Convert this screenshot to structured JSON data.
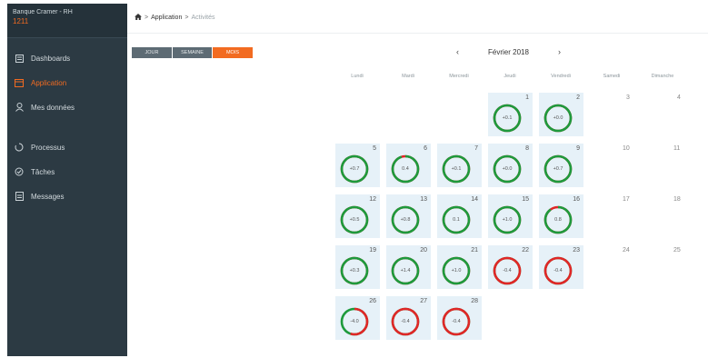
{
  "sidebar": {
    "brand_name": "Banque Cramer - RH",
    "brand_code": "1211",
    "items": [
      {
        "label": "Dashboards",
        "icon": "dashboard-icon"
      },
      {
        "label": "Application",
        "icon": "application-icon"
      },
      {
        "label": "Mes données",
        "icon": "user-icon"
      },
      {
        "label": "Processus",
        "icon": "process-icon"
      },
      {
        "label": "Tâches",
        "icon": "check-circle-icon"
      },
      {
        "label": "Messages",
        "icon": "messages-icon"
      }
    ]
  },
  "breadcrumb": {
    "home_icon": "home-icon",
    "item1": "Application",
    "item2": "Activités",
    "separator": ">"
  },
  "view_toggle": {
    "day": "JOUR",
    "week": "SEMAINE",
    "month": "MOIS"
  },
  "calendar": {
    "month_label": "Février 2018",
    "prev": "‹",
    "next": "›",
    "weekdays": [
      "Lundi",
      "Mardi",
      "Mercredi",
      "Jeudi",
      "Vendredi",
      "Samedi",
      "Dimanche"
    ],
    "weekend_days": {
      "3": "3",
      "4": "4",
      "10": "10",
      "11": "11",
      "17": "17",
      "18": "18",
      "24": "24",
      "25": "25"
    },
    "days": [
      {
        "day": "1",
        "value": "+0.1",
        "ring_fraction": 1.0,
        "color": "#1e9a3c"
      },
      {
        "day": "2",
        "value": "+0.0",
        "ring_fraction": 1.0,
        "color": "#1e9a3c"
      },
      {
        "day": "5",
        "value": "+0.7",
        "ring_fraction": 1.0,
        "color": "#1e9a3c"
      },
      {
        "day": "6",
        "value": "0.4",
        "ring_fraction": 0.95,
        "color": "#1e9a3c"
      },
      {
        "day": "7",
        "value": "+0.1",
        "ring_fraction": 1.0,
        "color": "#1e9a3c"
      },
      {
        "day": "8",
        "value": "+0.0",
        "ring_fraction": 1.0,
        "color": "#1e9a3c"
      },
      {
        "day": "9",
        "value": "+0.7",
        "ring_fraction": 1.0,
        "color": "#1e9a3c"
      },
      {
        "day": "12",
        "value": "+0.5",
        "ring_fraction": 1.0,
        "color": "#1e9a3c"
      },
      {
        "day": "13",
        "value": "+0.8",
        "ring_fraction": 1.0,
        "color": "#1e9a3c"
      },
      {
        "day": "14",
        "value": "0.1",
        "ring_fraction": 1.0,
        "color": "#1e9a3c"
      },
      {
        "day": "15",
        "value": "+1.0",
        "ring_fraction": 1.0,
        "color": "#1e9a3c"
      },
      {
        "day": "16",
        "value": "0.8",
        "ring_fraction": 0.9,
        "color": "#1e9a3c"
      },
      {
        "day": "19",
        "value": "+0.3",
        "ring_fraction": 1.0,
        "color": "#1e9a3c"
      },
      {
        "day": "20",
        "value": "+1.4",
        "ring_fraction": 1.0,
        "color": "#1e9a3c"
      },
      {
        "day": "21",
        "value": "+1.0",
        "ring_fraction": 1.0,
        "color": "#1e9a3c"
      },
      {
        "day": "22",
        "value": "-0.4",
        "ring_fraction": 1.0,
        "color": "#e02727"
      },
      {
        "day": "23",
        "value": "-0.4",
        "ring_fraction": 1.0,
        "color": "#e02727"
      },
      {
        "day": "26",
        "value": "-4.0",
        "ring_fraction": 0.55,
        "color": "#e02727"
      },
      {
        "day": "27",
        "value": "-0.4",
        "ring_fraction": 1.0,
        "color": "#e02727"
      },
      {
        "day": "28",
        "value": "-0.4",
        "ring_fraction": 1.0,
        "color": "#e02727"
      }
    ]
  },
  "colors": {
    "accent": "#f26b21",
    "sidebar_bg": "#2c3a43",
    "positive": "#1e9a3c",
    "negative": "#e02727",
    "cell_bg": "#e6f1f8"
  }
}
